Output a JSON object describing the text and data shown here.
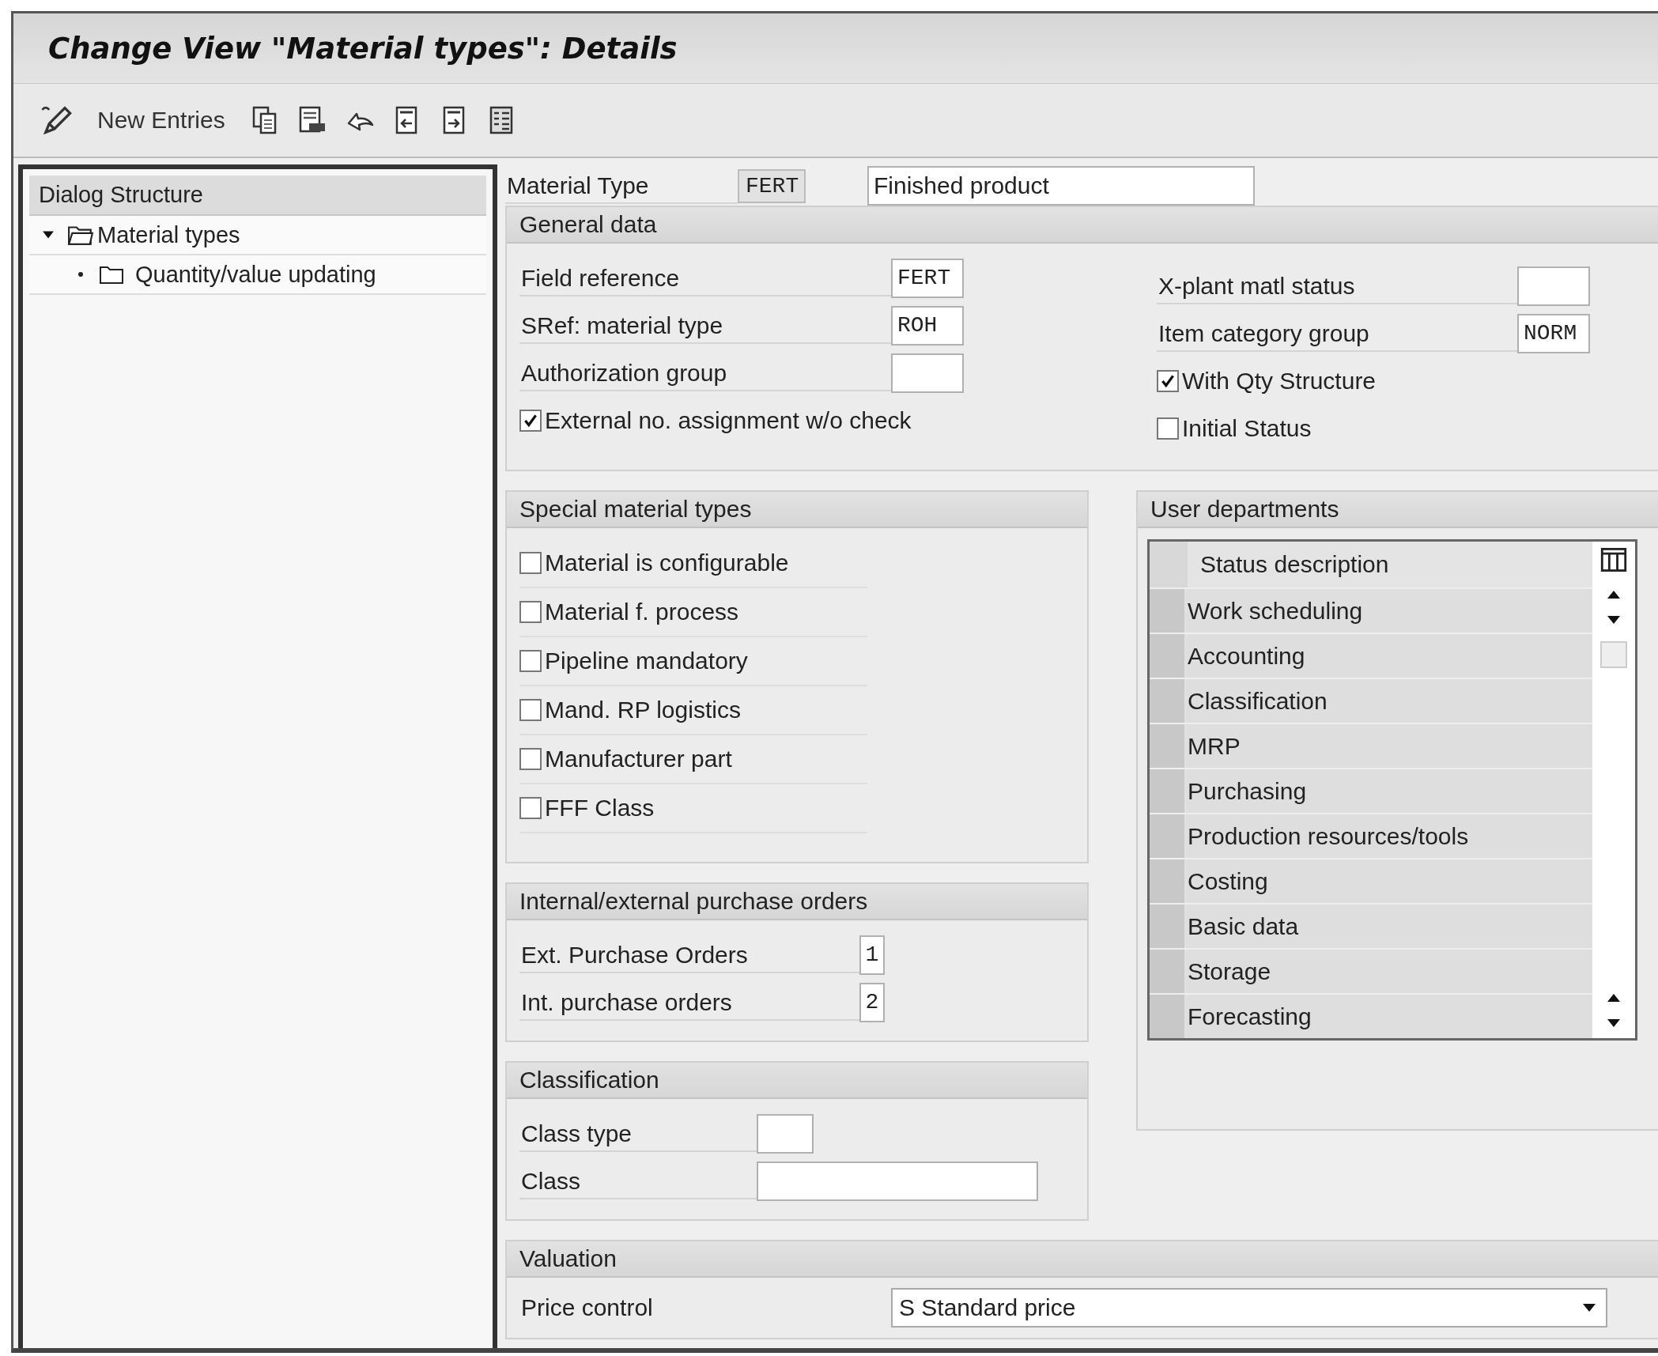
{
  "window": {
    "title": "Change View \"Material types\": Details"
  },
  "toolbar": {
    "button": "New Entries"
  },
  "dialog_structure": {
    "title": "Dialog Structure",
    "items": [
      {
        "label": "Material types",
        "expanded": true,
        "children": [
          {
            "label": "Quantity/value updating"
          }
        ]
      }
    ]
  },
  "material_type": {
    "label": "Material Type",
    "code": "FERT",
    "description": "Finished product"
  },
  "general_data": {
    "title": "General data",
    "left": [
      {
        "kind": "field",
        "label": "Field reference",
        "value": "FERT"
      },
      {
        "kind": "field",
        "label": "SRef: material type",
        "value": "ROH"
      },
      {
        "kind": "field",
        "label": "Authorization group"
      },
      {
        "kind": "checkbox",
        "label": "External no. assignment w/o check",
        "checked": true
      }
    ],
    "right": [
      {
        "kind": "field",
        "label": "X-plant matl status"
      },
      {
        "kind": "field",
        "label": "Item category group",
        "value": "NORM"
      },
      {
        "kind": "checkbox",
        "label": "With Qty Structure",
        "checked": true
      },
      {
        "kind": "checkbox",
        "label": "Initial Status",
        "checked": false
      }
    ]
  },
  "special_material_types": {
    "title": "Special material types",
    "options": [
      {
        "label": "Material is configurable",
        "checked": false
      },
      {
        "label": "Material f. process",
        "checked": false
      },
      {
        "label": "Pipeline mandatory",
        "checked": false
      },
      {
        "label": "Mand. RP logistics",
        "checked": false
      },
      {
        "label": "Manufacturer part",
        "checked": false
      },
      {
        "label": "FFF Class",
        "checked": false
      }
    ]
  },
  "purchase_orders": {
    "title": "Internal/external purchase orders",
    "fields": [
      {
        "label": "Ext. Purchase Orders",
        "value": "1"
      },
      {
        "label": "Int. purchase orders",
        "value": "2"
      }
    ]
  },
  "classification": {
    "title": "Classification",
    "fields": [
      {
        "label": "Class type",
        "kind": "short"
      },
      {
        "label": "Class",
        "kind": "long"
      }
    ]
  },
  "user_departments": {
    "title": "User departments",
    "column": "Status description",
    "rows": [
      {
        "label": "Work scheduling",
        "selected": false
      },
      {
        "label": "Accounting",
        "selected": false
      },
      {
        "label": "Classification",
        "selected": false
      },
      {
        "label": "MRP",
        "selected": false
      },
      {
        "label": "Purchasing",
        "selected": false
      },
      {
        "label": "Production resources/tools",
        "selected": false
      },
      {
        "label": "Costing",
        "selected": false
      },
      {
        "label": "Basic data",
        "selected": false
      },
      {
        "label": "Storage",
        "selected": false
      },
      {
        "label": "Forecasting",
        "selected": false
      }
    ]
  },
  "valuation": {
    "title": "Valuation",
    "fields": [
      {
        "label": "Price control",
        "value": "S Standard price"
      }
    ]
  }
}
